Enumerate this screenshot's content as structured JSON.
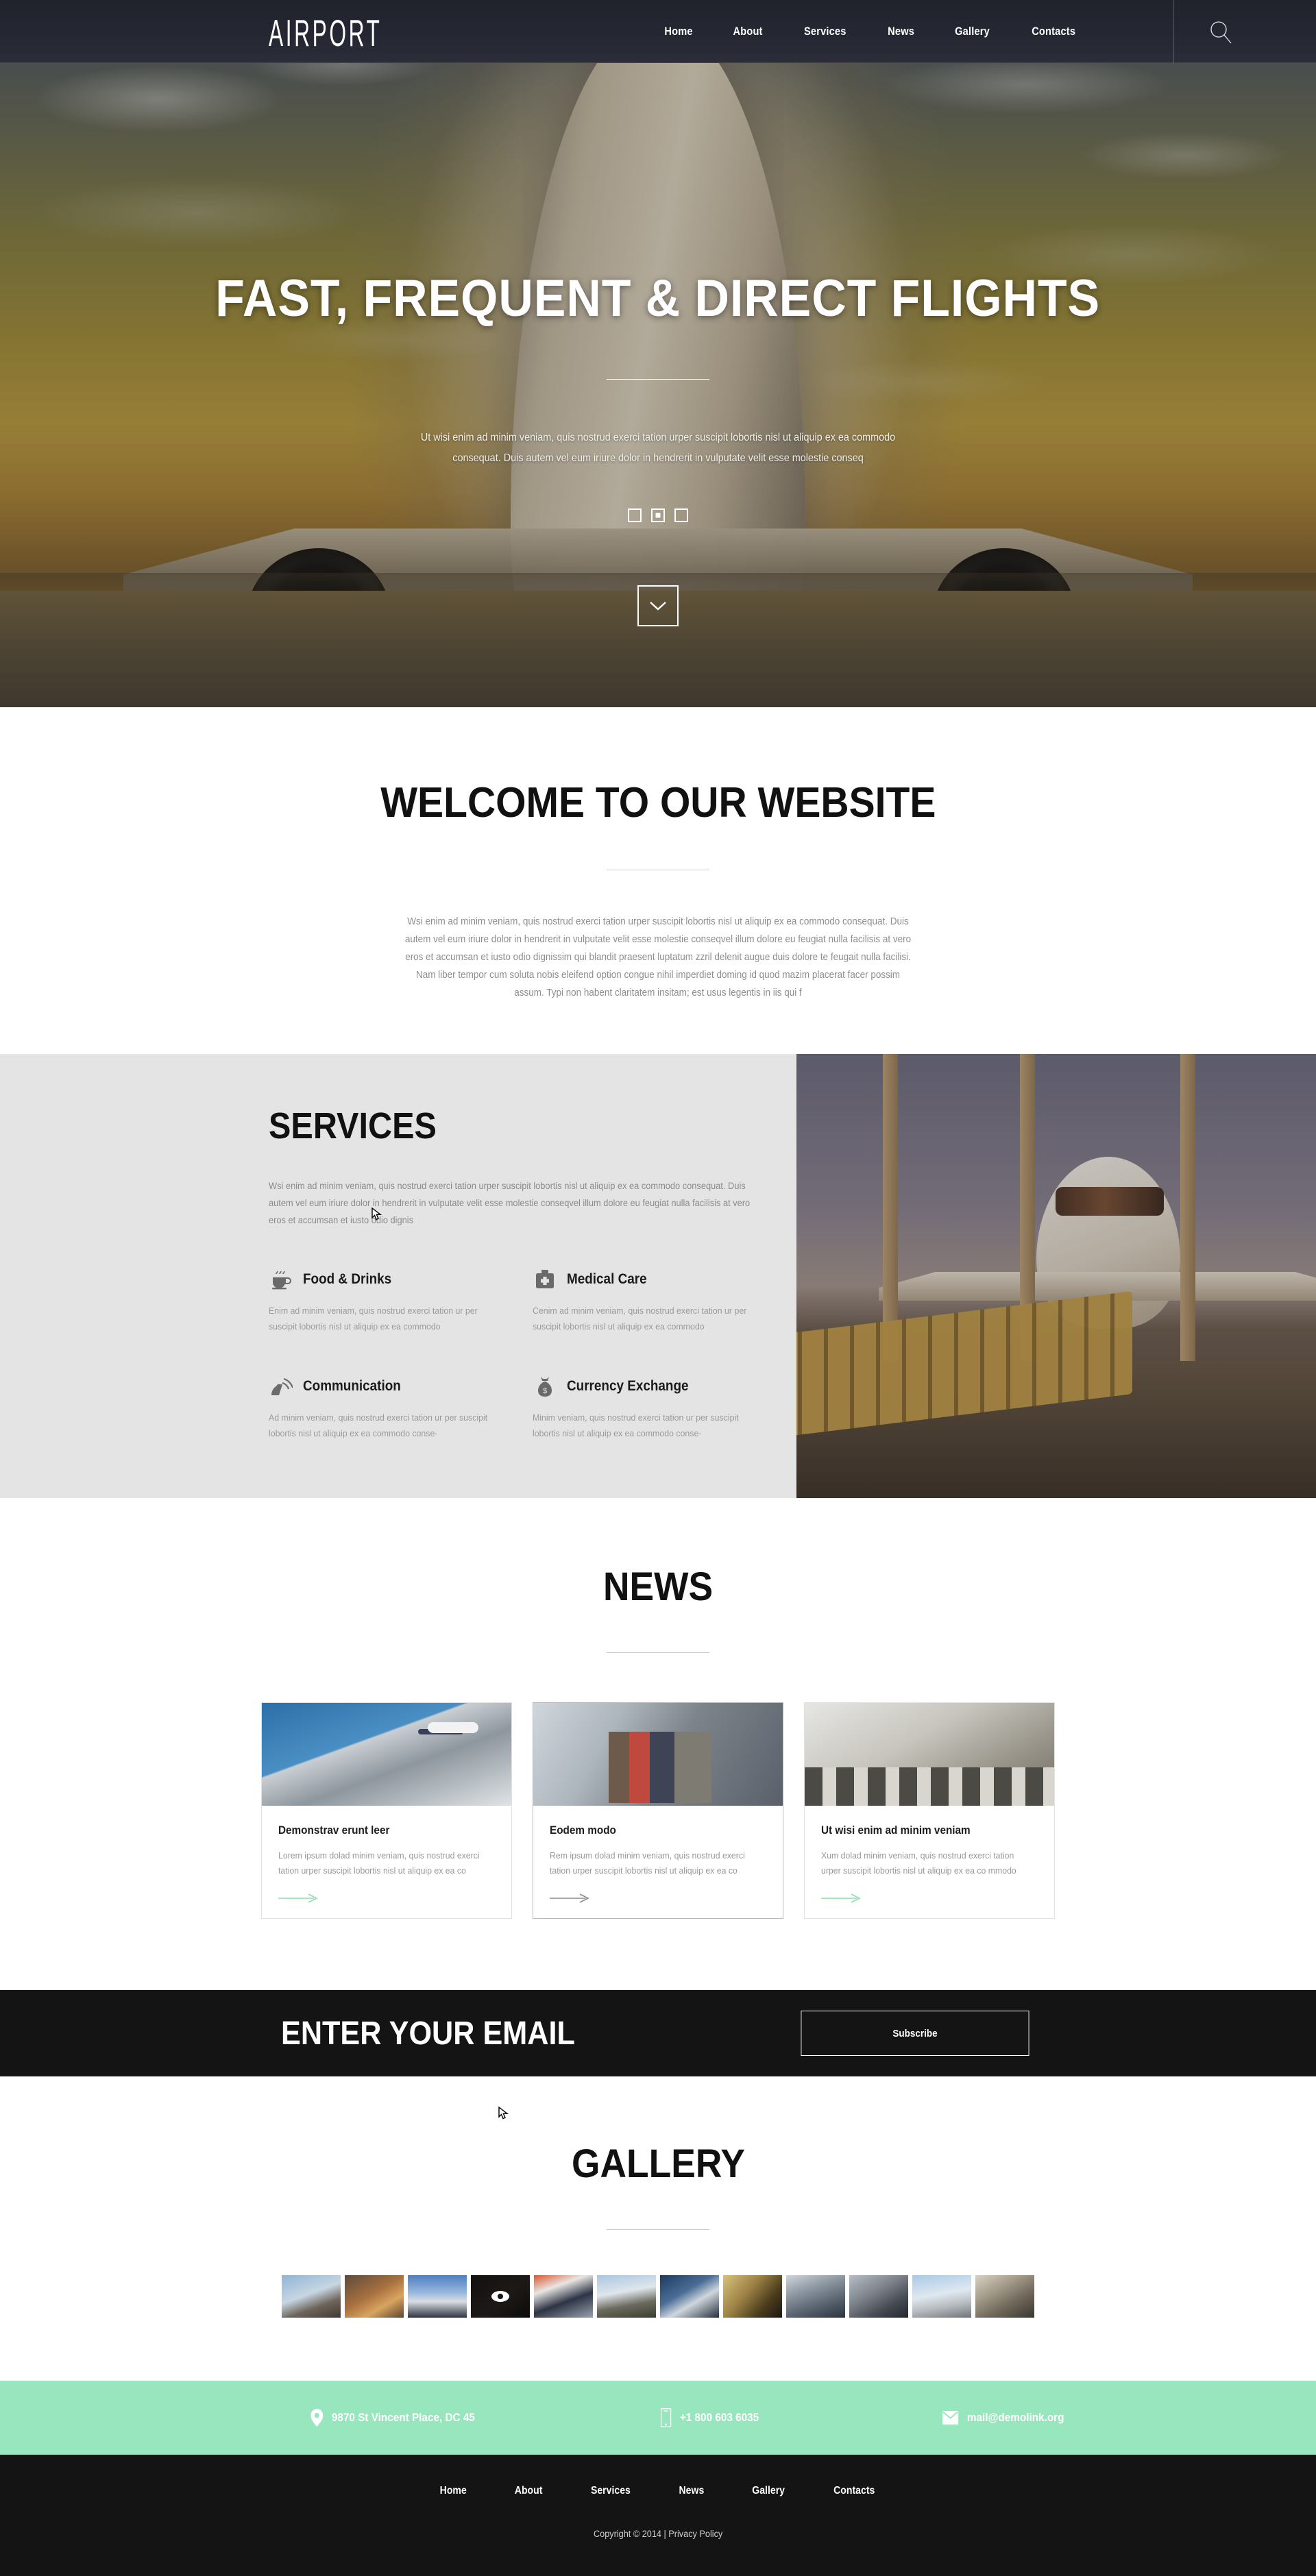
{
  "header": {
    "logo": "AIRPORT",
    "nav": [
      {
        "label": "Home"
      },
      {
        "label": "About"
      },
      {
        "label": "Services"
      },
      {
        "label": "News"
      },
      {
        "label": "Gallery"
      },
      {
        "label": "Contacts"
      }
    ],
    "search_icon": "search-icon"
  },
  "hero": {
    "title": "FAST, FREQUENT & DIRECT FLIGHTS",
    "subtitle": "Ut wisi enim ad minim veniam, quis nostrud exerci tation urper suscipit lobortis nisl ut aliquip ex ea commodo consequat. Duis autem vel eum iriure dolor in hendrerit in vulputate velit esse molestie conseq",
    "slides": [
      {
        "active": false
      },
      {
        "active": true
      },
      {
        "active": false
      }
    ],
    "scroll_icon": "chevron-down-icon"
  },
  "welcome": {
    "title": "WELCOME TO OUR WEBSITE",
    "body": "Wsi enim ad minim veniam, quis nostrud exerci tation urper suscipit lobortis nisl ut aliquip ex ea commodo consequat. Duis autem vel eum iriure dolor in hendrerit in vulputate velit esse molestie conseqvel illum dolore eu feugiat nulla facilisis at vero eros et accumsan et iusto odio dignissim qui blandit praesent luptatum zzril delenit augue duis dolore te feugait nulla facilisi. Nam liber tempor cum soluta nobis eleifend option congue nihil imperdiet doming id quod mazim placerat facer possim assum. Typi non habent claritatem insitam; est usus legentis in iis qui f"
  },
  "services": {
    "title": "SERVICES",
    "description": "Wsi enim ad minim veniam, quis nostrud exerci tation urper suscipit lobortis nisl ut aliquip ex ea commodo consequat. Duis autem vel eum iriure dolor in hendrerit in vulputate velit esse molestie conseqvel illum dolore eu feugiat nulla facilisis at vero eros et accumsan et iusto odio dignis",
    "items": [
      {
        "icon": "coffee-cup-icon",
        "title": "Food & Drinks",
        "text": "Enim ad minim veniam, quis nostrud exerci tation ur per suscipit lobortis nisl ut aliquip ex ea commodo"
      },
      {
        "icon": "medical-kit-icon",
        "title": "Medical Care",
        "text": "Cenim ad minim veniam, quis nostrud exerci tation ur per suscipit lobortis nisl ut aliquip ex ea commodo"
      },
      {
        "icon": "satellite-dish-icon",
        "title": "Communication",
        "text": "Ad minim veniam, quis nostrud exerci tation ur per suscipit lobortis nisl ut aliquip ex ea commodo conse-"
      },
      {
        "icon": "money-bag-icon",
        "title": "Currency Exchange",
        "text": "Minim veniam, quis nostrud exerci tation ur per suscipit lobortis nisl ut aliquip ex ea commodo conse-"
      }
    ]
  },
  "news": {
    "title": "NEWS",
    "cards": [
      {
        "image": "airport-terminal-plane-photo",
        "title": "Demonstrav erunt leer",
        "text": "Lorem ipsum dolad minim veniam, quis nostrud exerci tation urper suscipit lobortis nisl ut aliquip ex ea co",
        "arrow_color": "#8fdcb2"
      },
      {
        "image": "business-people-airport-photo",
        "title": "Eodem modo",
        "text": "Rem ipsum dolad minim veniam, quis nostrud exerci tation urper suscipit lobortis nisl ut aliquip ex ea co",
        "arrow_color": "#8b8b8b"
      },
      {
        "image": "airport-control-room-photo",
        "title": "Ut wisi enim ad minim veniam",
        "text": "Xum dolad minim veniam, quis nostrud exerci tation urper suscipit lobortis nisl ut aliquip ex ea co mmodo",
        "arrow_color": "#8fdcb2"
      }
    ]
  },
  "subscribe": {
    "title": "ENTER YOUR EMAIL",
    "button_label": "Subscribe"
  },
  "gallery": {
    "title": "GALLERY",
    "thumbs": [
      {
        "name": "plane-boarding-stairs",
        "hover": false
      },
      {
        "name": "sunset-terminal-window",
        "hover": false
      },
      {
        "name": "plane-tail-rear-view",
        "hover": false
      },
      {
        "name": "dark-plane-silhouette",
        "hover": true
      },
      {
        "name": "flight-crew-team",
        "hover": false
      },
      {
        "name": "lax-theme-building",
        "hover": false
      },
      {
        "name": "jet-engine-closeup",
        "hover": false
      },
      {
        "name": "golden-terminal-interior",
        "hover": false
      },
      {
        "name": "plane-over-building",
        "hover": false
      },
      {
        "name": "rolling-luggage",
        "hover": false
      },
      {
        "name": "wing-above-clouds",
        "hover": false
      },
      {
        "name": "terminal-curbside",
        "hover": false
      }
    ],
    "overlay_icon": "eye-icon"
  },
  "contact": {
    "address": {
      "icon": "map-pin-icon",
      "text": "9870 St Vincent Place, DC 45"
    },
    "phone": {
      "icon": "phone-icon",
      "text": "+1 800 603 6035"
    },
    "email": {
      "icon": "envelope-icon",
      "text": "mail@demolink.org"
    }
  },
  "footer": {
    "nav": [
      {
        "label": "Home"
      },
      {
        "label": "About"
      },
      {
        "label": "Services"
      },
      {
        "label": "News"
      },
      {
        "label": "Gallery"
      },
      {
        "label": "Contacts"
      }
    ],
    "copyright": "Copyright © 2014 | Privacy Policy"
  },
  "colors": {
    "accent_green": "#97e6bd",
    "dark": "#141414",
    "services_bg": "#e4e4e4",
    "header_bg": "#252733"
  }
}
